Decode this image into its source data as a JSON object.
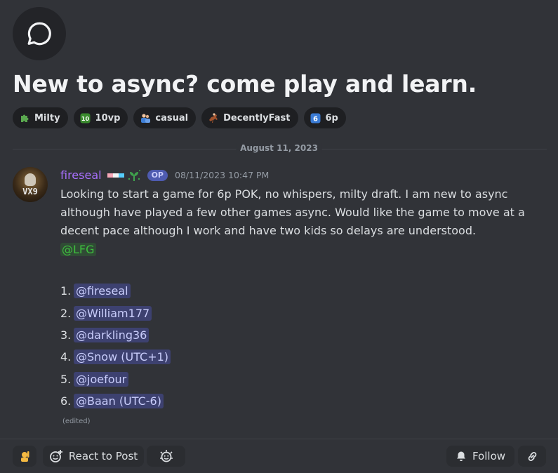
{
  "post": {
    "title": "New to async? come play and learn.",
    "header_icon": "chat-bubble-icon",
    "tags": [
      {
        "icon": "puzzle-piece-icon",
        "label": "Milty"
      },
      {
        "icon": "keycap-ten-icon",
        "label": "10vp"
      },
      {
        "icon": "people-icon",
        "label": "casual"
      },
      {
        "icon": "horse-racing-icon",
        "label": "DecentlyFast"
      },
      {
        "icon": "keycap-six-icon",
        "label": "6p"
      }
    ]
  },
  "divider": {
    "date": "August 11, 2023"
  },
  "message": {
    "author": "fireseal",
    "author_color": "#a970ff",
    "op_badge": "OP",
    "timestamp": "08/11/2023 10:47 PM",
    "avatar_text": "VX9",
    "body_lines": [
      "Looking to start a game for 6p POK, no whispers, milty draft. I am new to async although have played a few other games async. Would like the game to move at a decent pace although I work and have two kids so delays are understood."
    ],
    "role_mention": "@LFG",
    "list": [
      {
        "num": "1.",
        "mention": "@fireseal"
      },
      {
        "num": "2.",
        "mention": "@William177"
      },
      {
        "num": "3.",
        "mention": "@darkling36"
      },
      {
        "num": "4.",
        "mention": "@Snow (UTC+1)"
      },
      {
        "num": "5.",
        "mention": "@joefour"
      },
      {
        "num": "6.",
        "mention": "@Baan (UTC-6)"
      }
    ],
    "edited": "(edited)"
  },
  "actions": {
    "react_label": "React to Post",
    "follow_label": "Follow"
  },
  "colors": {
    "background": "#313338",
    "role_mention": "#3ebf3e",
    "user_mention": "#c9cdfb"
  }
}
